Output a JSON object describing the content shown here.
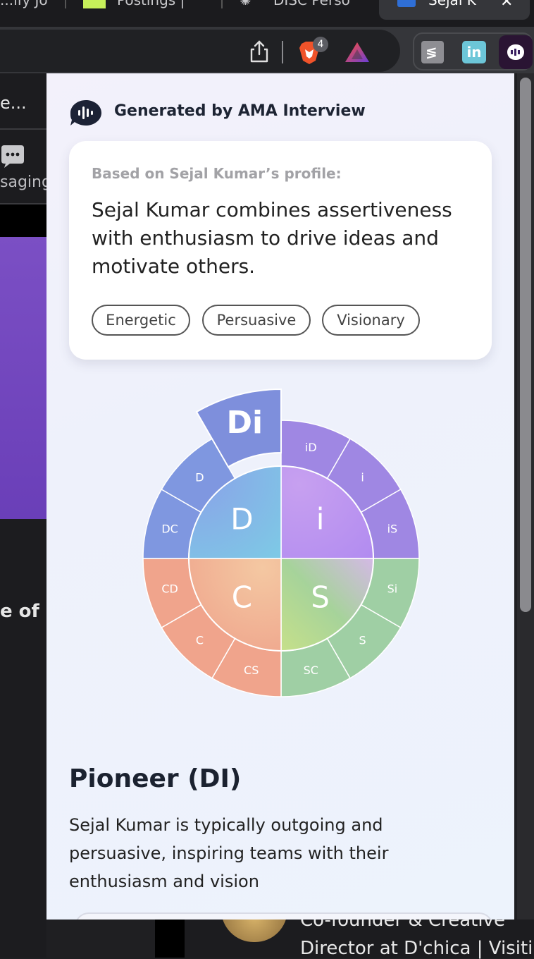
{
  "browser": {
    "tabs": [
      {
        "label": "...ify Jo"
      },
      {
        "label": "Postings |"
      },
      {
        "label": "DISC Perso"
      },
      {
        "label": "Sejal K"
      }
    ],
    "brave_badge_count": "4"
  },
  "background_page": {
    "snippet_1": "e...",
    "snippet_2": "saging",
    "snippet_3": "e of",
    "bottom_line_1": "Co-founder & Creative",
    "bottom_line_2": "Director at D'chica | Visitir"
  },
  "panel": {
    "brand_title": "Generated by AMA Interview",
    "summary_label": "Based on Sejal Kumar’s profile:",
    "summary_text": "Sejal Kumar combines assertiveness with enthusiasm to drive ideas and motivate others.",
    "traits": [
      "Energetic",
      "Persuasive",
      "Visionary"
    ],
    "disc_wheel": {
      "highlighted": "Di",
      "inner_letters": [
        "D",
        "i",
        "S",
        "C"
      ],
      "outer_segments": [
        "iD",
        "i",
        "iS",
        "Si",
        "S",
        "SC",
        "CS",
        "C",
        "CD",
        "DC",
        "D"
      ],
      "colors": {
        "D": "#7f97e0",
        "i": "#9f87e3",
        "S": "#9fcfa4",
        "C": "#f0a48c",
        "highlight": "#7e8fdc"
      }
    },
    "type_title": "Pioneer (DI)",
    "type_description": "Sejal Kumar is typically outgoing and persuasive, inspiring teams with their enthusiasm and vision"
  }
}
